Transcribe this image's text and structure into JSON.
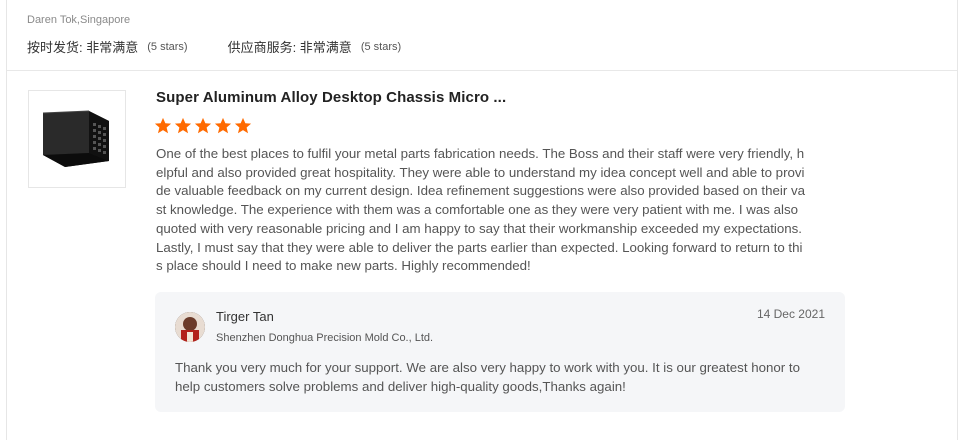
{
  "previous_review": {
    "reviewer": "Daren Tok,Singapore",
    "ratings": [
      {
        "label": "按时发货: 非常满意",
        "stars": "(5 stars)"
      },
      {
        "label": "供应商服务: 非常满意",
        "stars": "(5 stars)"
      }
    ]
  },
  "review": {
    "product_image_icon": "metal-chassis-image",
    "product_title": "Super Aluminum Alloy Desktop Chassis Micro ...",
    "rating": 5,
    "star_color": "#ff6a00",
    "text": "One of the best places to fulfil your metal parts fabrication needs. The Boss and their staff were very friendly, helpful and also provided great hospitality. They were able to understand my idea concept well and able to provide valuable feedback on my current design. Idea refinement suggestions were also provided based on their vast knowledge. The experience with them was a comfortable one as they were very patient with me. I was also quoted with very reasonable pricing and I am happy to say that their workmanship exceeded my expectations. Lastly, I must say that they were able to deliver the parts earlier than expected. Looking forward to return to this place should I need to make new parts. Highly recommended!"
  },
  "reply": {
    "name": "Tirger Tan",
    "company": "Shenzhen Donghua Precision Mold Co., Ltd.",
    "date": "14 Dec 2021",
    "text": "Thank you very much for your support. We are also very happy to work with you. It is our greatest honor to help customers solve problems and deliver high-quality goods,Thanks again!"
  }
}
